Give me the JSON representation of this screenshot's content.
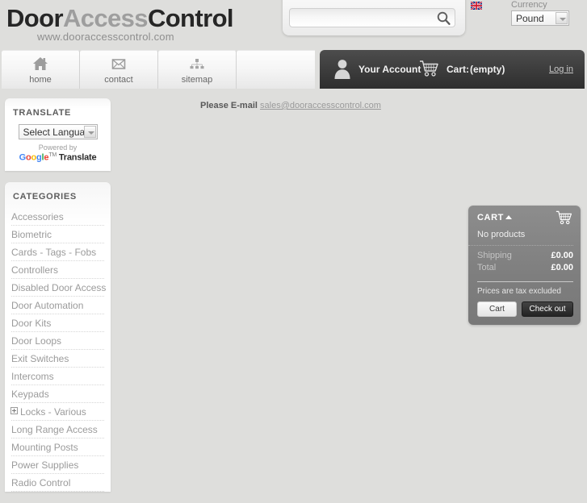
{
  "header": {
    "logo": {
      "part1": "Door",
      "part2": "Access",
      "part3": "Control",
      "subtitle": "www.dooraccesscontrol.com"
    },
    "search": {
      "value": "",
      "placeholder": "",
      "icon": "search-icon"
    },
    "language_flag": "uk-flag-icon",
    "currency": {
      "label": "Currency",
      "selected": "Pound",
      "options": [
        "Pound"
      ]
    }
  },
  "nav": {
    "tabs": [
      {
        "label": "home",
        "icon": "house-icon"
      },
      {
        "label": "contact",
        "icon": "envelope-icon"
      },
      {
        "label": "sitemap",
        "icon": "sitemap-icon"
      }
    ],
    "account": {
      "icon": "user-icon",
      "label": "Your Account",
      "cart_icon": "shopping-cart-icon",
      "cart_word": "Cart:",
      "cart_state": "(empty)",
      "login_label": "Log in"
    }
  },
  "sidebar": {
    "translate": {
      "title": "TRANSLATE",
      "select_value": "Select Language",
      "powered_by": "Powered by",
      "brand": {
        "g": "G",
        "o1": "o",
        "o2": "o",
        "g2": "g",
        "l": "l",
        "e": "e",
        "tm": "TM",
        "word": "Translate"
      }
    },
    "categories": {
      "title": "CATEGORIES",
      "items": [
        {
          "label": "Accessories",
          "expandable": false
        },
        {
          "label": "Biometric",
          "expandable": false
        },
        {
          "label": "Cards - Tags - Fobs",
          "expandable": false
        },
        {
          "label": "Controllers",
          "expandable": false
        },
        {
          "label": "Disabled Door Access",
          "expandable": false
        },
        {
          "label": "Door Automation",
          "expandable": false
        },
        {
          "label": "Door Kits",
          "expandable": false
        },
        {
          "label": "Door Loops",
          "expandable": false
        },
        {
          "label": "Exit Switches",
          "expandable": false
        },
        {
          "label": "Intercoms",
          "expandable": false
        },
        {
          "label": "Keypads",
          "expandable": false
        },
        {
          "label": "Locks - Various",
          "expandable": true
        },
        {
          "label": "Long Range Access",
          "expandable": false
        },
        {
          "label": "Mounting Posts",
          "expandable": false
        },
        {
          "label": "Power Supplies",
          "expandable": false
        },
        {
          "label": "Radio Control",
          "expandable": false
        }
      ]
    }
  },
  "main": {
    "email_prefix": "Please E-mail",
    "email_address": "sales@dooraccesscontrol.com"
  },
  "cart_block": {
    "title": "CART",
    "icon": "shopping-cart-icon",
    "no_products": "No products",
    "rows": [
      {
        "label": "Shipping",
        "value": "£0.00"
      },
      {
        "label": "Total",
        "value": "£0.00"
      }
    ],
    "tax_note": "Prices are tax excluded",
    "cart_button": "Cart",
    "checkout_button": "Check out"
  },
  "colors": {
    "page_background": "#dededc",
    "panel_white": "#ffffff",
    "dark_bar": "#3d3d3d",
    "cart_gray": "#7e7e7e",
    "logo_dark": "#262626",
    "logo_light": "#9e9e9e"
  }
}
